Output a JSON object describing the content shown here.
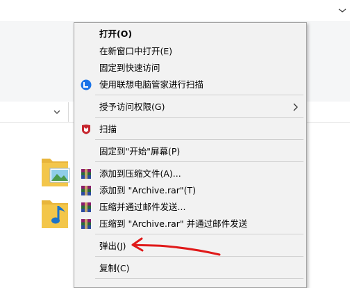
{
  "colors": {
    "menu_bg": "#f2f2f2",
    "menu_border": "#a0a0a0",
    "annotation_red": "#e01919",
    "pc_manager_blue": "#1a73e8",
    "scan_red": "#c6262e",
    "folder_yellow": "#f3c64a"
  },
  "explorer": {
    "icons": [
      "chevron-down-icon",
      "image-folder-icon",
      "music-folder-icon"
    ]
  },
  "context_menu": {
    "items": [
      {
        "label": "打开(O)",
        "bold": true
      },
      {
        "label": "在新窗口中打开(E)"
      },
      {
        "label": "固定到快速访问"
      },
      {
        "label": "使用联想电脑管家进行扫描",
        "icon": "lenovo-pc-manager-icon"
      },
      {
        "label": "授予访问权限(G)",
        "submenu": true
      },
      {
        "label": "扫描",
        "icon": "mcafee-shield-icon"
      },
      {
        "label": "固定到\"开始\"屏幕(P)"
      },
      {
        "label": "添加到压缩文件(A)...",
        "icon": "winrar-icon"
      },
      {
        "label": "添加到 \"Archive.rar\"(T)",
        "icon": "winrar-icon"
      },
      {
        "label": "压缩并通过邮件发送...",
        "icon": "winrar-icon"
      },
      {
        "label": "压缩到 \"Archive.rar\" 并通过邮件发送",
        "icon": "winrar-icon"
      },
      {
        "label": "弹出(J)"
      },
      {
        "label": "复制(C)"
      }
    ]
  }
}
